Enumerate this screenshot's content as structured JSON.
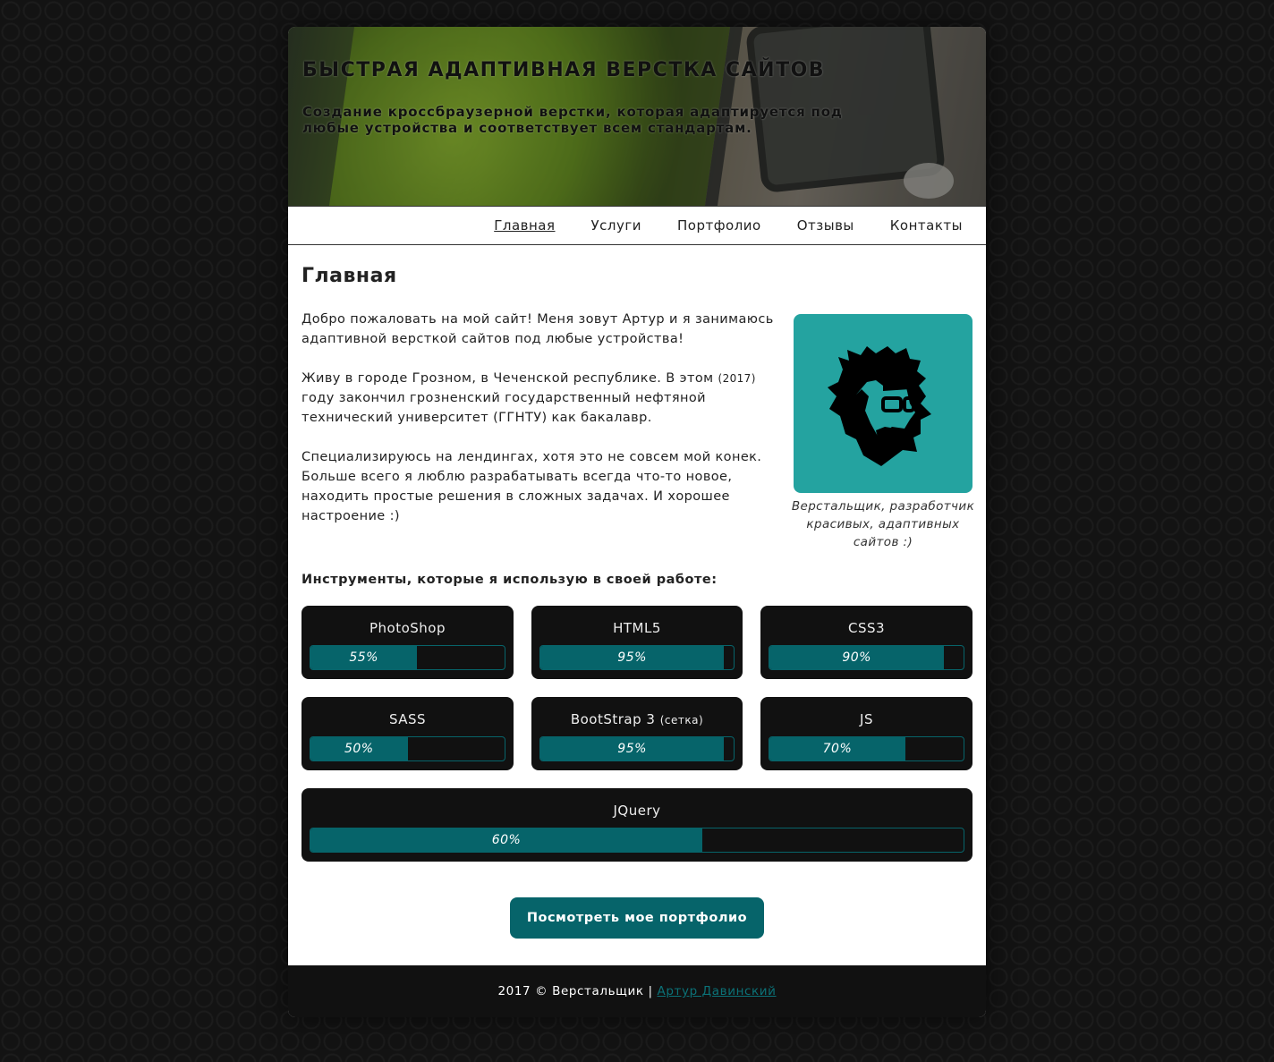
{
  "header": {
    "title": "БЫСТРАЯ АДАПТИВНАЯ ВЕРСТКА САЙТОВ",
    "subtitle": "Создание кроссбраузерной верстки, которая адаптируется под любые устройства и соответствует всем стандартам."
  },
  "nav": {
    "items": [
      {
        "label": "Главная"
      },
      {
        "label": "Услуги"
      },
      {
        "label": "Портфолио"
      },
      {
        "label": "Отзывы"
      },
      {
        "label": "Контакты"
      }
    ]
  },
  "main": {
    "heading": "Главная",
    "p1": "Добро пожаловать на мой сайт! Меня зовут Артур и я занимаюсь адаптивной версткой сайтов под любые устройства!",
    "p2_a": "Живу в городе Грозном, в Чеченской республике. В этом ",
    "p2_year": "(2017)",
    "p2_b": " году закончил грозненский государственный нефтяной технический университет (ГГНТУ) как бакалавр.",
    "p3": "Специализируюсь на лендингах, хотя это не совсем мой конек. Больше всего я люблю разрабатывать всегда что-то новое, находить простые решения в сложных задачах. И хорошее настроение :)",
    "avatar_caption": "Верстальщик, разработчик красивых, адаптивных сайтов :)",
    "tools_title": "Инструменты, которые я использую в своей работе:",
    "skills": [
      {
        "name": "PhotoShop",
        "note": "",
        "level": 0.55,
        "label": "55%"
      },
      {
        "name": "HTML5",
        "note": "",
        "level": 0.95,
        "label": "95%"
      },
      {
        "name": "CSS3",
        "note": "",
        "level": 0.9,
        "label": "90%"
      },
      {
        "name": "SASS",
        "note": "",
        "level": 0.5,
        "label": "50%"
      },
      {
        "name": "BootStrap 3 ",
        "note": "(сетка)",
        "level": 0.95,
        "label": "95%"
      },
      {
        "name": "JS",
        "note": "",
        "level": 0.7,
        "label": "70%"
      },
      {
        "name": "JQuery",
        "note": "",
        "level": 0.6,
        "label": "60%"
      }
    ],
    "cta_label": "Посмотреть мое портфолио"
  },
  "footer": {
    "text": "2017 © Верстальщик | ",
    "link": "Артур Давинский"
  },
  "colors": {
    "accent": "#06646a",
    "avatar_bg": "#24a3a0",
    "page_bg": "#131313"
  }
}
